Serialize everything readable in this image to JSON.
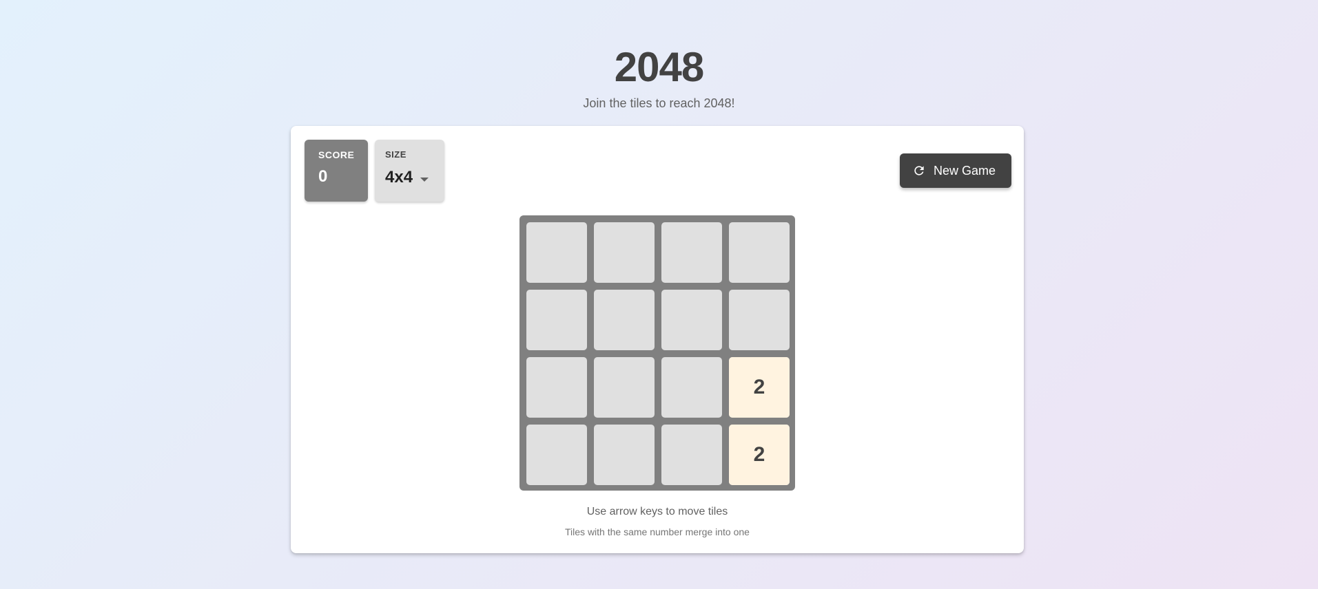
{
  "header": {
    "title": "2048",
    "subtitle": "Join the tiles to reach 2048!"
  },
  "score": {
    "label": "SCORE",
    "value": "0"
  },
  "size": {
    "label": "SIZE",
    "value": "4x4"
  },
  "toolbar": {
    "new_game_label": "New Game",
    "new_game_icon": "refresh-icon"
  },
  "board": {
    "size": 4,
    "grid": [
      [
        null,
        null,
        null,
        null
      ],
      [
        null,
        null,
        null,
        null
      ],
      [
        null,
        null,
        null,
        "2"
      ],
      [
        null,
        null,
        null,
        "2"
      ]
    ]
  },
  "instructions": {
    "primary": "Use arrow keys to move tiles",
    "secondary": "Tiles with the same number merge into one"
  },
  "colors": {
    "board": "#808080",
    "empty_cell": "#e0e0e0",
    "tile_2": "#fff3e0",
    "button": "#424242"
  }
}
